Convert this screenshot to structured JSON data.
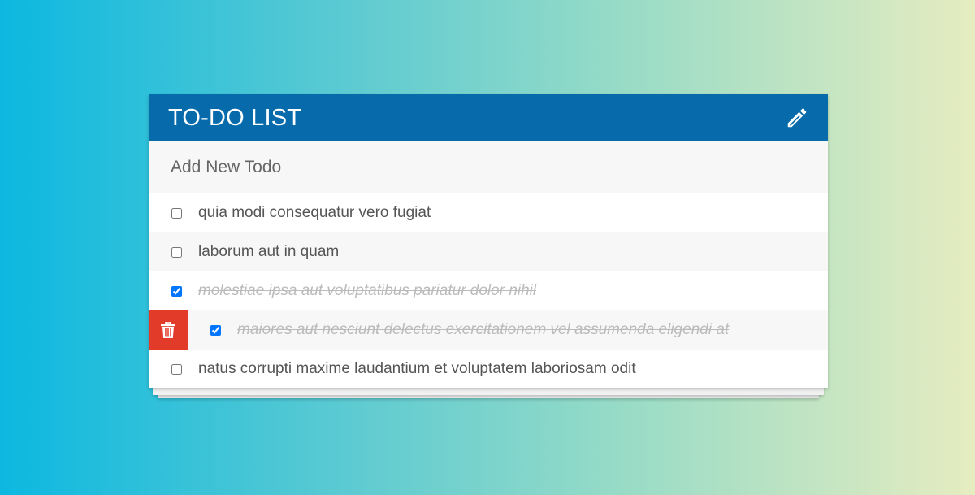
{
  "app": {
    "title": "TO-DO LIST",
    "header_icon": "pencil-icon",
    "accent_color": "#066aab",
    "delete_color": "#e23b2a"
  },
  "add_todo": {
    "placeholder": "Add New Todo",
    "value": ""
  },
  "todos": [
    {
      "text": "quia modi consequatur vero fugiat",
      "completed": false
    },
    {
      "text": "laborum aut in quam",
      "completed": false
    },
    {
      "text": "molestiae ipsa aut voluptatibus pariatur dolor nihil",
      "completed": true
    },
    {
      "text": "maiores aut nesciunt delectus exercitationem vel assumenda eligendi at",
      "completed": true,
      "hovered": true,
      "delete_icon": "trash-icon"
    },
    {
      "text": "natus corrupti maxime laudantium et voluptatem laboriosam odit",
      "completed": false
    }
  ]
}
